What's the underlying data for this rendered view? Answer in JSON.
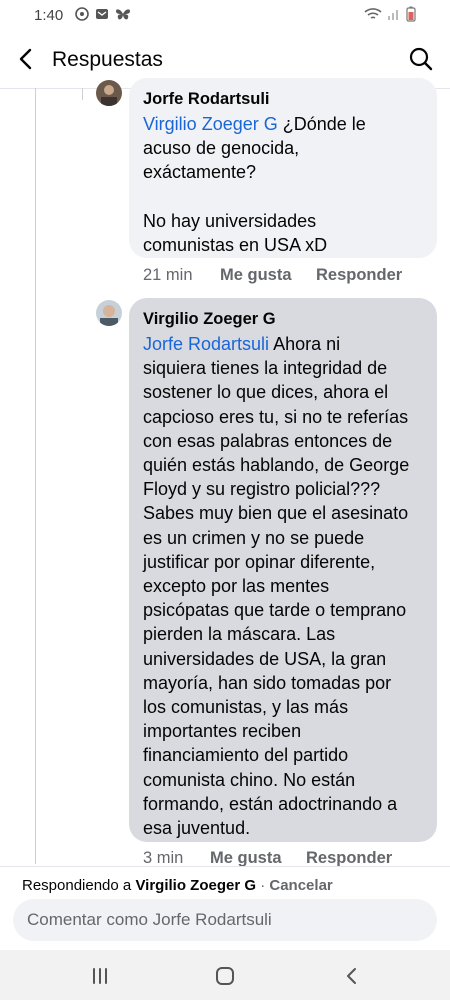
{
  "status": {
    "time": "1:40"
  },
  "header": {
    "title": "Respuestas"
  },
  "comments": [
    {
      "author": "Jorfe Rodartsuli",
      "mention": "Virgilio Zoeger G",
      "text": " ¿Dónde le\nacuso de genocida,\nexáctamente?\n\nNo hay universidades\ncomunistas en USA xD",
      "time": "21 min",
      "like": "Me gusta",
      "reply": "Responder"
    },
    {
      "author": "Virgilio Zoeger G",
      "mention": "Jorfe Rodartsuli",
      "text": " Ahora ni\nsiquiera tienes la integridad de\nsostener lo que dices, ahora el\ncapcioso eres tu, si no te referías\ncon esas palabras entonces de\nquién estás hablando, de George\nFloyd y su registro policial???\nSabes muy bien que el asesinato\nes un crimen y no se puede\njustificar por opinar diferente,\nexcepto por las mentes\npsicópatas que tarde o temprano\npierden la máscara. Las\nuniversidades de USA, la gran\nmayoría, han sido tomadas por\nlos comunistas, y las más\nimportantes reciben\nfinanciamiento del partido\ncomunista chino. No están\nformando, están adoctrinando a\nesa juventud.",
      "time": "3 min",
      "like": "Me gusta",
      "reply": "Responder"
    }
  ],
  "composer": {
    "replying_prefix": "Respondiendo a ",
    "replying_to": "Virgilio Zoeger G",
    "separator": " · ",
    "cancel": "Cancelar",
    "placeholder": "Comentar como Jorfe Rodartsuli"
  },
  "icons": [
    "back-arrow-icon",
    "search-icon",
    "recent-apps-icon",
    "home-icon",
    "back-nav-icon"
  ]
}
